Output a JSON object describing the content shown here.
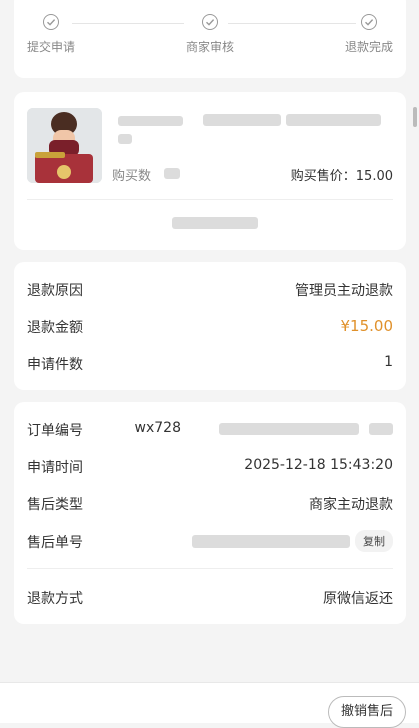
{
  "progress": {
    "steps": [
      {
        "label": "提交申请"
      },
      {
        "label": "商家审核"
      },
      {
        "label": "退款完成"
      }
    ]
  },
  "product": {
    "qty_label": "购买数",
    "price_label": "购买售价：15.00"
  },
  "refund": {
    "reason_key": "退款原因",
    "reason_val": "管理员主动退款",
    "amount_key": "退款金额",
    "amount_val": "¥15.00",
    "count_key": "申请件数",
    "count_val": "1"
  },
  "order": {
    "no_key": "订单编号",
    "no_val": "wx728",
    "time_key": "申请时间",
    "time_val": "2025-12-18 15:43:20",
    "type_key": "售后类型",
    "type_val": "商家主动退款",
    "after_key": "售后单号",
    "copy_label": "复制",
    "method_key": "退款方式",
    "method_val": "原微信返还"
  },
  "footer": {
    "cancel_label": "撤销售后"
  },
  "colors": {
    "accent": "#e0912b"
  }
}
